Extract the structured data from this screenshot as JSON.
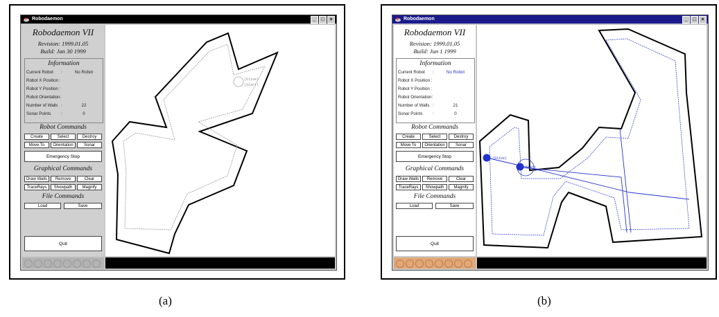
{
  "figure_labels": {
    "a": "(a)",
    "b": "(b)"
  },
  "window_a": {
    "title": "Robodaemon",
    "app_name": "Robodaemon VII",
    "revision": "Revision: 1999.01.05",
    "build": "Build: Jan 30 1999",
    "info_header": "Information",
    "info": [
      {
        "label": "Current Robot",
        "sep": ":",
        "value": "No Robot"
      },
      {
        "label": "Robot X Position :",
        "sep": "",
        "value": ""
      },
      {
        "label": "Robot Y Position :",
        "sep": "",
        "value": ""
      },
      {
        "label": "Robot Orientation:",
        "sep": "",
        "value": ""
      },
      {
        "label": "Number of Walls",
        "sep": ":",
        "value": "22"
      },
      {
        "label": "Sonar Points",
        "sep": ":",
        "value": "0"
      }
    ],
    "robot_header": "Robot Commands",
    "robot_buttons": [
      "Create",
      "Select",
      "Destroy",
      "Move To",
      "Orientation",
      "Sonar"
    ],
    "emergency": "Emergency Stop",
    "graphical_header": "Graphical Commands",
    "graphical_buttons": [
      "Draw Walls",
      "Remove",
      "Clear",
      "TraceRays",
      "Showpath",
      "Magnify"
    ],
    "file_header": "File Commands",
    "file_buttons": [
      "Load",
      "Save"
    ],
    "quit": "Quit",
    "canvas_labels": {
      "olive": "(Olive)",
      "start": "(Start)"
    }
  },
  "window_b": {
    "title": "Robodaemon",
    "app_name": "Robodaemon VII",
    "revision": "Revision: 1999.01.05",
    "build": "Build: Jun 1 1999",
    "info_header": "Information",
    "info": [
      {
        "label": "Current Robot",
        "sep": ":",
        "value": "No Robot",
        "accent": "#2233cc"
      },
      {
        "label": "Robot X Position :",
        "sep": "",
        "value": ""
      },
      {
        "label": "Robot Y Position :",
        "sep": "",
        "value": ""
      },
      {
        "label": "Robot Orientation:",
        "sep": "",
        "value": ""
      },
      {
        "label": "Number of Walls",
        "sep": ":",
        "value": "21"
      },
      {
        "label": "Sonar Points",
        "sep": ":",
        "value": "0"
      }
    ],
    "robot_header": "Robot Commands",
    "robot_buttons": [
      "Create",
      "Select",
      "Destroy",
      "Move To",
      "Orientation",
      "Sonar"
    ],
    "emergency": "Emergency Stop",
    "graphical_header": "Graphical Commands",
    "graphical_buttons": [
      "Draw Walls",
      "Remove",
      "Clear",
      "TraceRays",
      "Showpath",
      "Magnify"
    ],
    "file_header": "File Commands",
    "file_buttons": [
      "Load",
      "Save"
    ],
    "quit": "Quit",
    "canvas_labels": {
      "olive": "(Olive)",
      "start": "Start"
    }
  },
  "colors": {
    "titlebar_a": "#000000",
    "titlebar_b": "#1b1b8c",
    "path_b": "#2233cc",
    "deco_b": "#e0a878"
  }
}
